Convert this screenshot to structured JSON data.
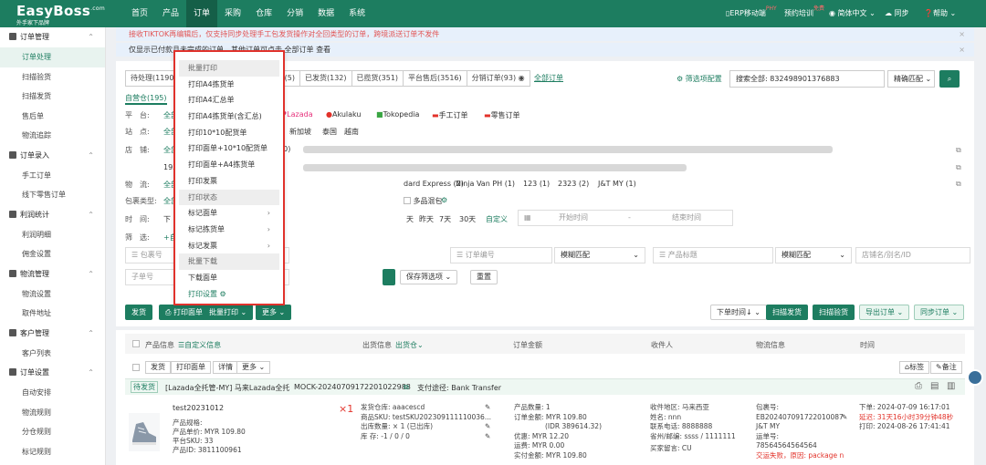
{
  "brand": {
    "name": "EasyBoss",
    "sup": ".com",
    "tagline": "外手家下品牌"
  },
  "nav": [
    "首页",
    "产品",
    "订单",
    "采购",
    "仓库",
    "分销",
    "数据",
    "系统"
  ],
  "top_right": {
    "erp": "ERP移动端",
    "erp_badge": "PHY",
    "training": "预约培训",
    "training_badge": "免费",
    "lang": "简体中文",
    "sync": "同步",
    "help": "帮助"
  },
  "sidebar": {
    "groups": [
      {
        "title": "订单管理",
        "items": [
          "订单处理",
          "扫描验货",
          "扫描发货",
          "售后单",
          "物流追踪"
        ]
      },
      {
        "title": "订单录入",
        "items": [
          "手工订单",
          "线下零售订单"
        ]
      },
      {
        "title": "利润统计",
        "items": [
          "利润明细",
          "佣金设置"
        ]
      },
      {
        "title": "物流管理",
        "items": [
          "物流设置",
          "取件地址"
        ]
      },
      {
        "title": "客户管理",
        "items": [
          "客户列表"
        ]
      },
      {
        "title": "订单设置",
        "items": [
          "自动安排",
          "物流规则",
          "分仓规则",
          "标记规则"
        ]
      }
    ]
  },
  "notices": [
    "接收TIKTOK再编辑后，仅支持同步处理手工包发货操作对全回类型的订单，跨境派送订单不发件",
    "仅显示已付款且未完成的订单，其他订单可点击 全部订单 查看"
  ],
  "notice_link": "全部订单",
  "notice_after": "查看",
  "status_tabs": [
    "待处理(1190)",
    "(5)",
    "已发货(132)",
    "已揽货(351)",
    "平台售后(3516)",
    "分销订单(93)"
  ],
  "all_orders": "全部订单",
  "filter_cfg": "筛选项配置",
  "search": {
    "label": "搜索全部:",
    "value": "832498901376883",
    "mode": "精确匹配"
  },
  "sub_tabs": {
    "active": "自营仓(195)"
  },
  "platforms": [
    "Lazada",
    "Akulaku",
    "Tokopedia",
    "手工订单",
    "零售订单"
  ],
  "site_label": "站点",
  "sites": [
    "新加坡",
    "泰国",
    "越南"
  ],
  "store_label": "店铺",
  "platform_label": "平台",
  "store_row2": "193",
  "logistics_label": "物流",
  "logistics": [
    "dard Express (2)",
    "Ninja Van PH (1)",
    "123 (1)",
    "2323 (2)",
    "J&T MY (1)"
  ],
  "package_label": "包裹类型",
  "multi_pkg": "多品混包",
  "time_label": "时间",
  "time_opts": [
    "天",
    "昨天",
    "7天",
    "30天",
    "自定义"
  ],
  "time_ph": {
    "start": "开始时间",
    "sep": "-",
    "end": "结束时间"
  },
  "filter_label": "筛选",
  "search_row": {
    "pkg": "包裹号",
    "order": "订单编号",
    "fuzzy1": "模糊匹配",
    "product": "产品标题",
    "fuzzy2": "模糊匹配",
    "store": "店铺名/别名/ID"
  },
  "row3": {
    "sub_no": "子单号",
    "save": "保存筛选项",
    "reset": "重置"
  },
  "actions": {
    "ship": "发货",
    "print": "打印面单",
    "batch": "批量打印",
    "more": "更多",
    "order_time": "下单时间",
    "scan_ship": "扫描发货",
    "scan_verify": "扫描验货",
    "export": "导出订单",
    "sync": "同步订单"
  },
  "table_head": {
    "product": "产品信息",
    "custom": "自定义信息",
    "storage": "出货信息",
    "wh": "出货仓",
    "amount": "订单金额",
    "buyer": "收件人",
    "logistics": "物流信息",
    "time": "时间"
  },
  "sub_buttons": [
    "发货",
    "打印面单",
    "详情",
    "更多"
  ],
  "row_tools": {
    "tag": "标签",
    "note": "备注"
  },
  "order": {
    "status": "待发货",
    "store": "[Lazada全托管-MY] 马来Lazada全托",
    "id": "MOCK-20240709172201022988",
    "pay": "支付途径: Bank Transfer",
    "product_name": "test20231012",
    "spec": "产品规格:",
    "price": "产品单价: MYR 109.80",
    "platform_sku": "平台SKU: 33",
    "product_id": "产品ID: 3811100961",
    "qty": "×1",
    "ship_wh": "发货仓库: aaacescd",
    "prod_sku": "商品SKU: testSKU202309111110036...",
    "out_qty": "出库数量: ×  1  (已出库)",
    "stock": "库      存: -1 / 0 / 0",
    "amt1": "产品数量: 1",
    "amt2": "订单金额: MYR 109.80",
    "amt3": "(IDR 389614.32)",
    "amt4": "优惠: MYR 12.20",
    "amt5": "运费: MYR 0.00",
    "amt6": "实付金额: MYR 109.80",
    "rc1": "收件地区: 马来西亚",
    "rc2": "姓名: nnn",
    "rc3": "联系电话: 8888888",
    "rc4": "省州/邮编: ssss / 1111111",
    "rc5": "买家留言: CU",
    "lg1": "包裹号:",
    "lg2": "EB202407091722010087",
    "lg3": "J&T MY",
    "lg4": "运单号:",
    "lg5": "78564564564564",
    "lg6": "交运失败，原因: package n",
    "t1": "下单: 2024-07-09 16:17:01",
    "t2": "延迟: 31天16小时39分钟48秒",
    "t3": "打印: 2024-08-26 17:41:41"
  },
  "dropdown": {
    "header1": "批量打印",
    "items": [
      "打印A4拣货单",
      "打印A4汇总单",
      "打印A4拣货单(含汇总)",
      "打印10*10配货单",
      "打印面单+10*10配货单",
      "打印面单+A4拣货单",
      "打印发票"
    ],
    "header2": "打印状态",
    "status_items": [
      "标记面单",
      "标记拣货单",
      "标记发票"
    ],
    "header3": "批量下载",
    "download": "下载面单",
    "settings": "打印设置"
  }
}
